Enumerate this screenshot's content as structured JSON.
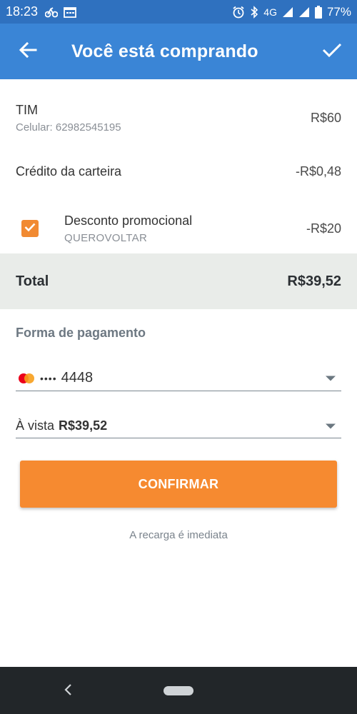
{
  "status_bar": {
    "time": "18:23",
    "network": "4G",
    "battery": "77%",
    "icons": [
      "bike-icon",
      "calendar-icon",
      "alarm-icon",
      "bluetooth-icon",
      "signal-icon",
      "battery-icon"
    ]
  },
  "app_bar": {
    "title": "Você está comprando",
    "back_icon": "arrow-left-icon",
    "confirm_icon": "check-icon"
  },
  "order": {
    "operator": "TIM",
    "phone": "Celular: 62982545195",
    "operator_amount": "R$60",
    "wallet_label": "Crédito da carteira",
    "wallet_amount": "-R$0,48",
    "discount_label": "Desconto promocional",
    "discount_code": "QUEROVOLTAR",
    "discount_amount": "-R$20",
    "discount_checked": true
  },
  "total": {
    "label": "Total",
    "amount": "R$39,52"
  },
  "payment": {
    "section_title": "Forma de pagamento",
    "card_dots": "••••",
    "card_last4": "4448",
    "installment_label": "À vista",
    "installment_amount": "R$39,52"
  },
  "confirm_button": "CONFIRMAR",
  "note": "A recarga é imediata",
  "colors": {
    "status_bar": "#2f71bf",
    "app_bar": "#3a85d6",
    "accent": "#f68a30",
    "total_band": "#e9ece9",
    "nav_bar": "#222629"
  }
}
